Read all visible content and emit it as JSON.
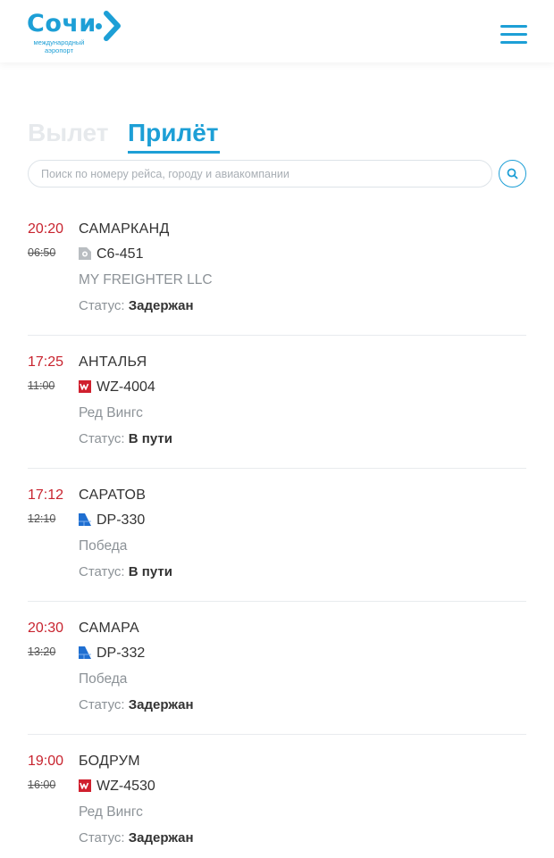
{
  "brand": {
    "name": "Сочи",
    "subtitle": "международный аэропорт",
    "color": "#1d9fd6"
  },
  "header": {
    "menu_icon": "hamburger-menu-icon"
  },
  "tabs": {
    "departures": "Вылет",
    "arrivals": "Прилёт",
    "active": "arrivals"
  },
  "search": {
    "placeholder": "Поиск по номеру рейса, городу и авиакомпании",
    "value": "",
    "icon": "search-icon"
  },
  "status_label": "Статус:",
  "flights": [
    {
      "time_actual": "20:20",
      "time_scheduled": "06:50",
      "city": "САМАРКАНД",
      "flight_number": "C6-451",
      "airline": "MY FREIGHTER LLC",
      "status": "Задержан",
      "airline_icon": "generic-airline-icon"
    },
    {
      "time_actual": "17:25",
      "time_scheduled": "11:00",
      "city": "АНТАЛЬЯ",
      "flight_number": "WZ-4004",
      "airline": "Ред Вингс",
      "status": "В пути",
      "airline_icon": "red-wings-icon"
    },
    {
      "time_actual": "17:12",
      "time_scheduled": "12:10",
      "city": "САРАТОВ",
      "flight_number": "DP-330",
      "airline": "Победа",
      "status": "В пути",
      "airline_icon": "pobeda-icon"
    },
    {
      "time_actual": "20:30",
      "time_scheduled": "13:20",
      "city": "САМАРА",
      "flight_number": "DP-332",
      "airline": "Победа",
      "status": "Задержан",
      "airline_icon": "pobeda-icon"
    },
    {
      "time_actual": "19:00",
      "time_scheduled": "16:00",
      "city": "БОДРУМ",
      "flight_number": "WZ-4530",
      "airline": "Ред Вингс",
      "status": "Задержан",
      "airline_icon": "red-wings-icon"
    }
  ],
  "colors": {
    "accent": "#1d9fd6",
    "time_actual": "#c8242f",
    "red_wings": "#d0202e",
    "pobeda": "#1f6fd1"
  }
}
